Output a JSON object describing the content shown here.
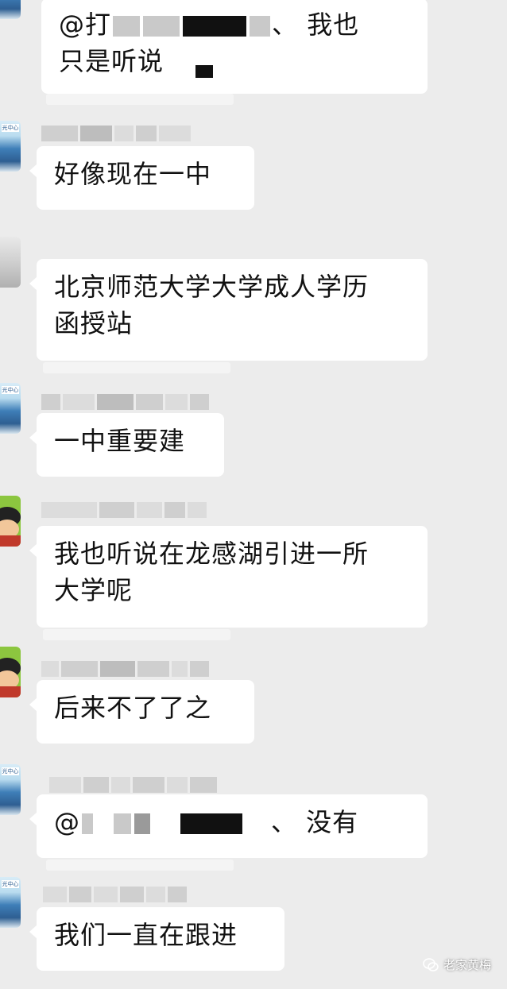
{
  "messages": [
    {
      "text_prefix": "@打",
      "text_suffix": "、 我也",
      "line2": "只是听说"
    },
    {
      "text": "好像现在一中"
    },
    {
      "line1": "北京师范大学大学成人学历",
      "line2": "函授站"
    },
    {
      "text": "一中重要建"
    },
    {
      "line1": "我也听说在龙感湖引进一所",
      "line2": "大学呢"
    },
    {
      "text": "后来不了了之"
    },
    {
      "text_prefix": "@",
      "text_suffix": "、 没有"
    },
    {
      "text": "我们一直在跟进"
    }
  ],
  "watermark": {
    "label": "老家黄梅",
    "icon": "wechat-official-account-icon"
  },
  "avatar_badge": "光中心",
  "colors": {
    "background": "#ececec",
    "bubble": "#ffffff",
    "text": "#111111"
  }
}
